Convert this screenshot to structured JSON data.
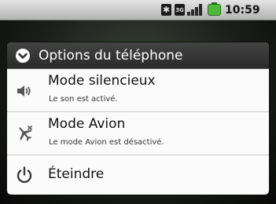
{
  "status_bar": {
    "time": "10:59 AM",
    "icons": [
      "bluetooth-icon",
      "network-3g-icon",
      "signal-icon",
      "battery-icon"
    ],
    "bluetooth_glyph": "✱",
    "network_glyph": "3G"
  },
  "dialog": {
    "title": "Options du téléphone",
    "items": [
      {
        "icon": "speaker-icon",
        "label": "Mode silencieux",
        "subtitle": "Le son est activé."
      },
      {
        "icon": "airplane-icon",
        "label": "Mode Avion",
        "subtitle": "Le mode Avion est désactivé."
      },
      {
        "icon": "power-icon",
        "label": "Éteindre"
      }
    ]
  },
  "colors": {
    "battery": "#4db93a",
    "header": "#333333",
    "dialog_bg": "#fbfbfb"
  }
}
